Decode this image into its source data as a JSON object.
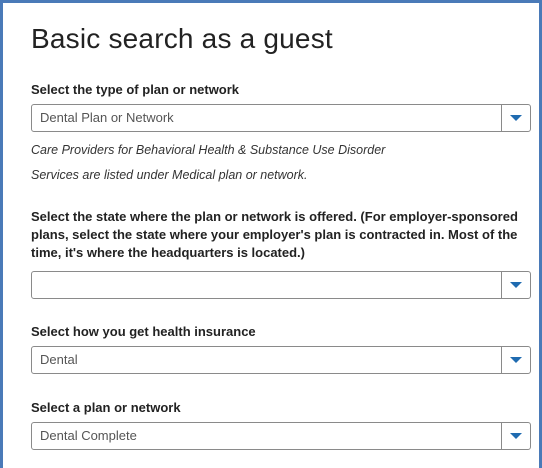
{
  "page": {
    "title": "Basic search as a guest"
  },
  "plan_type": {
    "label": "Select the type of plan or network",
    "selected": "Dental Plan or Network",
    "note_line1": "Care Providers for Behavioral Health & Substance Use Disorder",
    "note_line2": "Services are listed under Medical plan or network."
  },
  "state": {
    "label": "Select the state where the plan or network is offered. (For employer-sponsored plans, select the state where your employer's plan is contracted in. Most of the time, it's where the headquarters is located.)",
    "selected": ""
  },
  "insurance_source": {
    "label": "Select how you get health insurance",
    "selected": "Dental"
  },
  "plan": {
    "label": "Select a plan or network",
    "selected": "Dental Complete"
  },
  "icons": {
    "dropdown": "chevron-down-icon"
  },
  "colors": {
    "accent": "#1f6bb0",
    "panel_border": "#4a7ab8"
  }
}
